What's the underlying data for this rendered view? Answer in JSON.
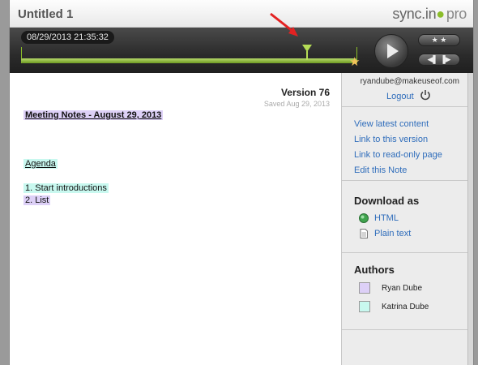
{
  "window": {
    "title": "Untitled 1"
  },
  "logo": {
    "brand": "sync.in",
    "suffix": "pro",
    "accent": "#8bbd2a"
  },
  "timeline": {
    "timestamp": "08/29/2013 21:35:32",
    "controls": {
      "play_icon": "play-icon",
      "star_nav": "★ ★",
      "step_nav": "◀▌ ▐▶"
    }
  },
  "document": {
    "version": "Version 76",
    "saved": "Saved Aug 29, 2013",
    "lines": {
      "heading": "Meeting Notes - August 29, 2013",
      "agenda": "Agenda",
      "item1": "1. Start introductions",
      "item2": "2. List"
    }
  },
  "account": {
    "email": "ryandube@makeuseof.com",
    "logout": "Logout"
  },
  "links": {
    "view_latest": "View latest content",
    "link_version": "Link to this version",
    "link_readonly": "Link to read-only page",
    "edit_note": "Edit this Note"
  },
  "download": {
    "title": "Download as",
    "html": "HTML",
    "plain": "Plain text"
  },
  "authors": {
    "title": "Authors",
    "list": [
      {
        "name": "Ryan Dube",
        "color": "#ddd0f7"
      },
      {
        "name": "Katrina Dube",
        "color": "#c8f8ef"
      }
    ]
  }
}
